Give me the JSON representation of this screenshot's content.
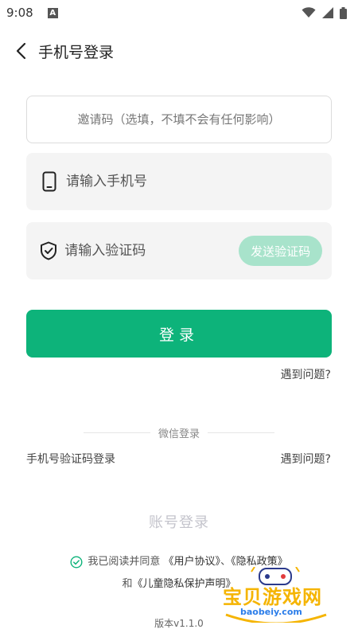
{
  "status_bar": {
    "time": "9:08",
    "notification_letter": "A"
  },
  "header": {
    "title": "手机号登录"
  },
  "form": {
    "invite_placeholder": "邀请码（选填，不填不会有任何影响）",
    "phone_placeholder": "请输入手机号",
    "code_placeholder": "请输入验证码",
    "send_code_label": "发送验证码",
    "login_label": "登录",
    "problem_label": "遇到问题?"
  },
  "alt_login": {
    "divider_label": "微信登录",
    "sms_login_label": "手机号验证码登录",
    "problem_label": "遇到问题?",
    "account_login_label": "账号登录"
  },
  "agreement": {
    "prefix": "我已阅读并同意",
    "user_agreement": "《用户协议》",
    "separator": "、",
    "privacy_policy": "《隐私政策》",
    "and": "和",
    "child_privacy": "《儿童隐私保护声明》"
  },
  "version": "版本v1.1.0",
  "watermark": {
    "brand": "宝贝游戏网",
    "url": "baobeiy.com"
  },
  "colors": {
    "accent": "#0db37a",
    "accent_light": "#a8e3cb"
  }
}
